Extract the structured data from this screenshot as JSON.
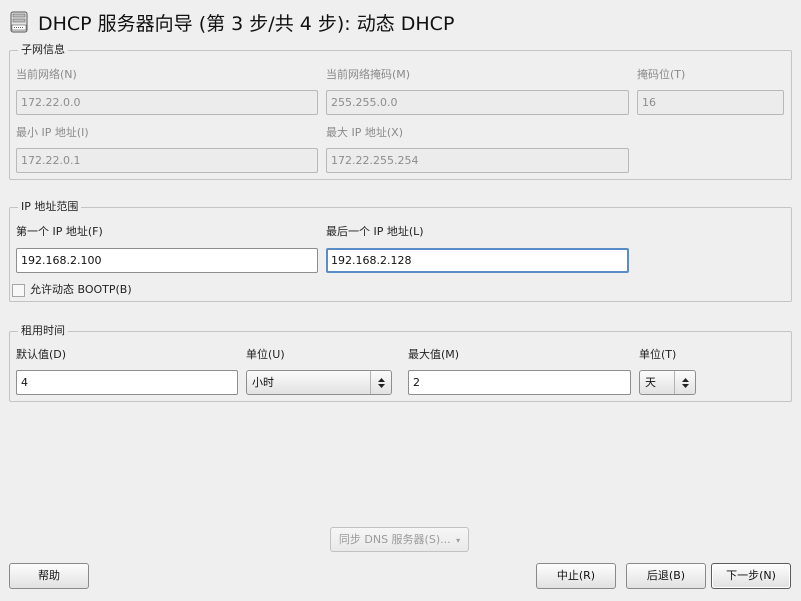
{
  "window": {
    "title": "DHCP 服务器向导 (第 3 步/共 4 步): 动态 DHCP"
  },
  "subnet": {
    "legend": "子网信息",
    "current_network_label": "当前网络(N)",
    "current_network_value": "172.22.0.0",
    "current_netmask_label": "当前网络掩码(M)",
    "current_netmask_value": "255.255.0.0",
    "netmask_bits_label": "掩码位(T)",
    "netmask_bits_value": "16",
    "min_ip_label": "最小 IP 地址(I)",
    "min_ip_value": "172.22.0.1",
    "max_ip_label": "最大 IP 地址(X)",
    "max_ip_value": "172.22.255.254"
  },
  "ip_range": {
    "legend": "IP 地址范围",
    "first_ip_label": "第一个 IP 地址(F)",
    "first_ip_value": "192.168.2.100",
    "last_ip_label": "最后一个 IP 地址(L)",
    "last_ip_value": "192.168.2.128",
    "bootp_label": "允许动态 BOOTP(B)",
    "bootp_checked": false
  },
  "lease": {
    "legend": "租用时间",
    "default_label": "默认值(D)",
    "default_value": "4",
    "default_unit_label": "单位(U)",
    "default_unit_value": "小时",
    "max_label": "最大值(M)",
    "max_value": "2",
    "max_unit_label": "单位(T)",
    "max_unit_value": "天"
  },
  "buttons": {
    "sync_dns": "同步 DNS 服务器(S)...",
    "help": "帮助",
    "abort": "中止(R)",
    "back": "后退(B)",
    "next": "下一步(N)"
  }
}
